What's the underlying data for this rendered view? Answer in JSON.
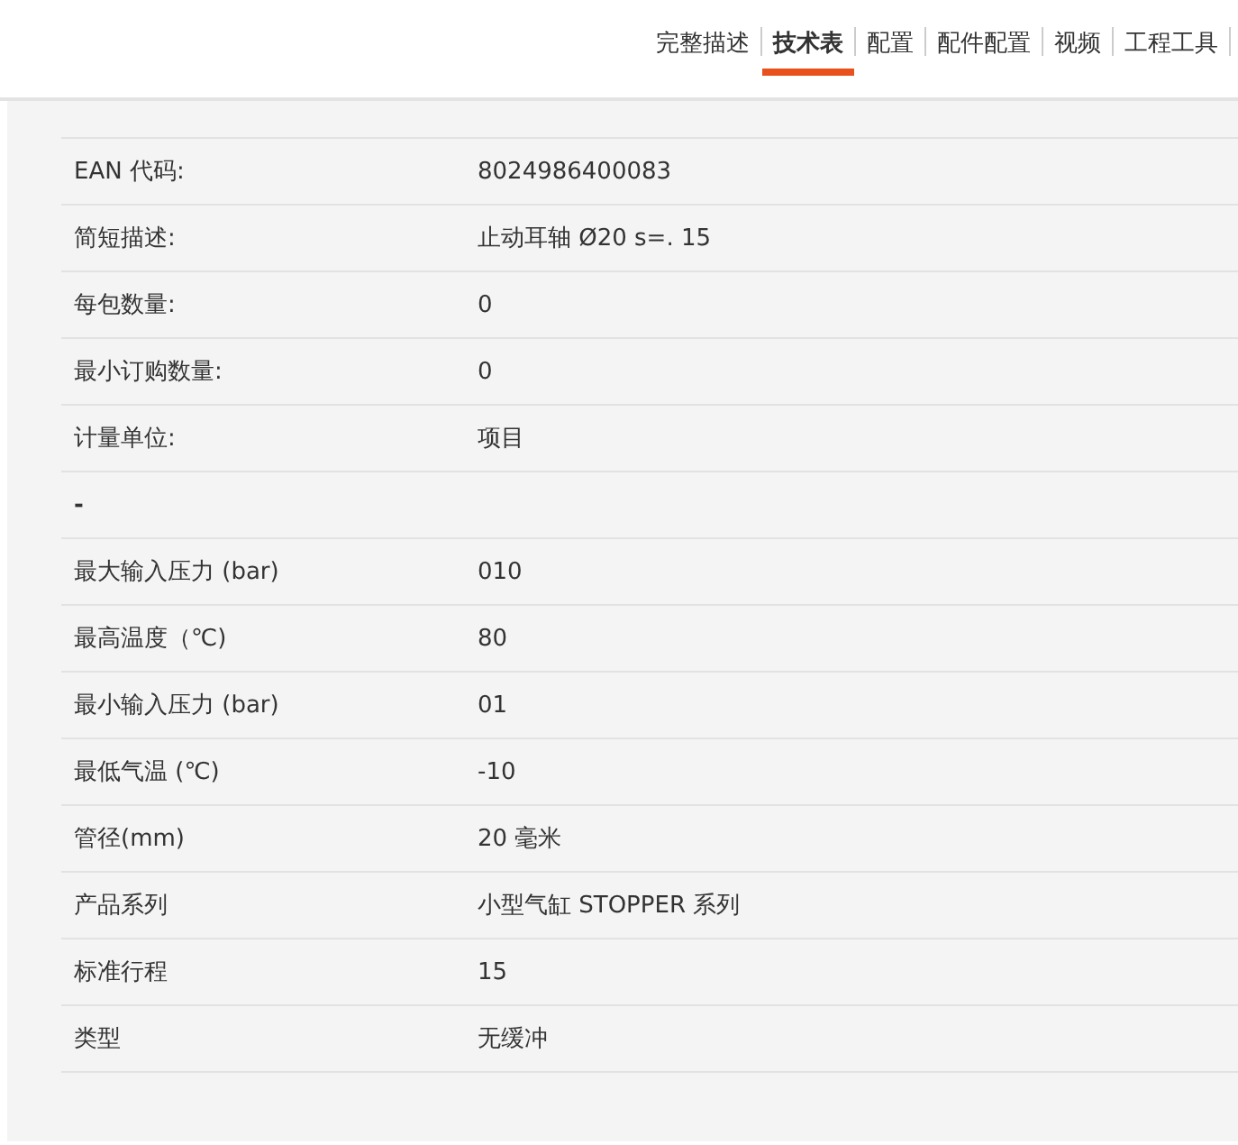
{
  "tabs": [
    {
      "label": "完整描述",
      "selected": false
    },
    {
      "label": "技术表",
      "selected": true
    },
    {
      "label": "配置",
      "selected": false
    },
    {
      "label": "配件配置",
      "selected": false
    },
    {
      "label": "视频",
      "selected": false
    },
    {
      "label": "工程工具",
      "selected": false
    }
  ],
  "rows": [
    {
      "kind": "row",
      "label": "EAN 代码:",
      "value": "8024986400083"
    },
    {
      "kind": "row",
      "label": "简短描述:",
      "value": "止动耳轴 Ø20 s=. 15"
    },
    {
      "kind": "row",
      "label": "每包数量:",
      "value": "0"
    },
    {
      "kind": "row",
      "label": "最小订购数量:",
      "value": "0"
    },
    {
      "kind": "row",
      "label": "计量单位:",
      "value": "项目"
    },
    {
      "kind": "header",
      "label": "-"
    },
    {
      "kind": "row",
      "label": "最大输入压力 (bar)",
      "value": "010"
    },
    {
      "kind": "row",
      "label": "最高温度（℃)",
      "value": "80"
    },
    {
      "kind": "row",
      "label": "最小输入压力 (bar)",
      "value": "01"
    },
    {
      "kind": "row",
      "label": "最低气温 (℃)",
      "value": "-10"
    },
    {
      "kind": "row",
      "label": "管径(mm)",
      "value": "20 毫米"
    },
    {
      "kind": "row",
      "label": "产品系列",
      "value": "小型气缸 STOPPER 系列"
    },
    {
      "kind": "row",
      "label": "标准行程",
      "value": "15"
    },
    {
      "kind": "row",
      "label": "类型",
      "value": "无缓冲"
    }
  ]
}
